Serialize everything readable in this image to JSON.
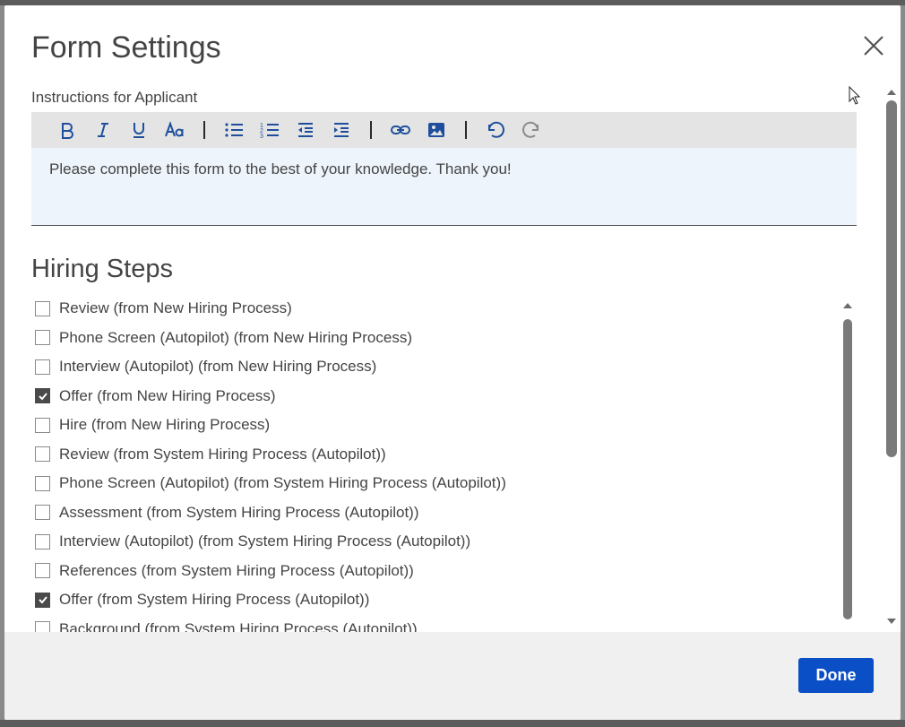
{
  "modal": {
    "title": "Form Settings",
    "instructions_label": "Instructions for Applicant",
    "editor": {
      "toolbar": [
        "bold-icon",
        "italic-icon",
        "underline-icon",
        "font-size-icon",
        "bullet-list-icon",
        "numbered-list-icon",
        "outdent-icon",
        "indent-icon",
        "link-icon",
        "image-icon",
        "undo-icon",
        "redo-icon"
      ],
      "content": "Please complete this form to the best of your knowledge. Thank you!"
    },
    "hiring_steps_title": "Hiring Steps",
    "hiring_steps": [
      {
        "label": "Review (from New Hiring Process)",
        "checked": false
      },
      {
        "label": "Phone Screen (Autopilot) (from New Hiring Process)",
        "checked": false
      },
      {
        "label": "Interview (Autopilot) (from New Hiring Process)",
        "checked": false
      },
      {
        "label": "Offer (from New Hiring Process)",
        "checked": true
      },
      {
        "label": "Hire (from New Hiring Process)",
        "checked": false
      },
      {
        "label": "Review (from System Hiring Process (Autopilot))",
        "checked": false
      },
      {
        "label": "Phone Screen (Autopilot) (from System Hiring Process (Autopilot))",
        "checked": false
      },
      {
        "label": "Assessment (from System Hiring Process (Autopilot))",
        "checked": false
      },
      {
        "label": "Interview (Autopilot) (from System Hiring Process (Autopilot))",
        "checked": false
      },
      {
        "label": "References (from System Hiring Process (Autopilot))",
        "checked": false
      },
      {
        "label": "Offer (from System Hiring Process (Autopilot))",
        "checked": true
      },
      {
        "label": "Background (from System Hiring Process (Autopilot))",
        "checked": false
      }
    ],
    "done_label": "Done"
  },
  "colors": {
    "accent": "#0b4fc7",
    "toolbar_icon": "#1f4f9c",
    "editor_bg": "#eef4fc"
  }
}
